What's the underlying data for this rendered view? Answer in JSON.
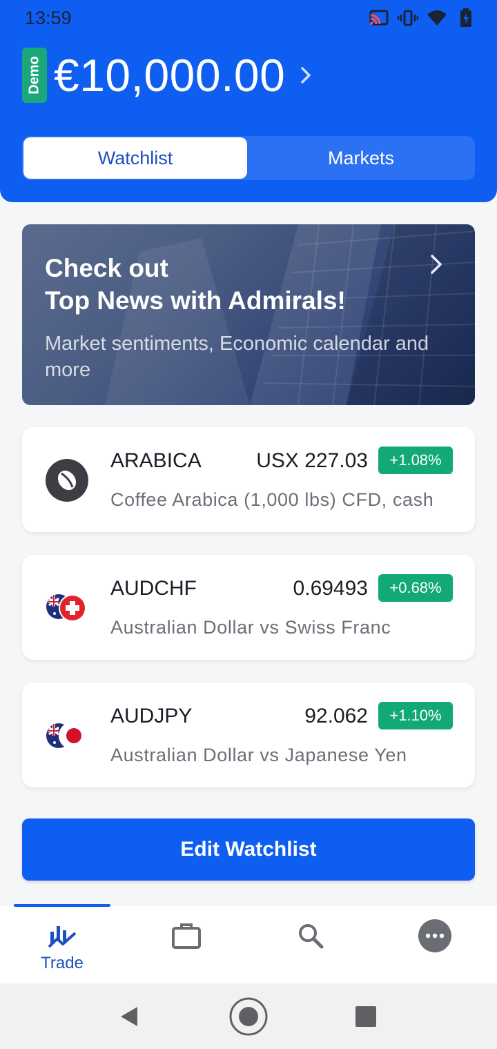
{
  "status_bar": {
    "time": "13:59"
  },
  "account": {
    "badge": "Demo",
    "balance": "€10,000.00"
  },
  "tabs": [
    {
      "label": "Watchlist",
      "active": true
    },
    {
      "label": "Markets",
      "active": false
    }
  ],
  "banner": {
    "title_line1": "Check out",
    "title_line2": "Top News with Admirals!",
    "subtitle": "Market sentiments, Economic calendar and more"
  },
  "watchlist": [
    {
      "symbol": "ARABICA",
      "price": "USX 227.03",
      "change": "+1.08%",
      "description": "Coffee Arabica (1,000 lbs) CFD, cash",
      "icon": "coffee-bean-icon"
    },
    {
      "symbol": "AUDCHF",
      "price": "0.69493",
      "change": "+0.68%",
      "description": "Australian Dollar vs Swiss Franc",
      "icon": "au-ch-flags-icon"
    },
    {
      "symbol": "AUDJPY",
      "price": "92.062",
      "change": "+1.10%",
      "description": "Australian Dollar vs Japanese Yen",
      "icon": "au-jp-flags-icon"
    }
  ],
  "edit_button": "Edit Watchlist",
  "bottom_nav": [
    {
      "label": "Trade",
      "icon": "trade-chart-icon",
      "active": true
    },
    {
      "label": "",
      "icon": "briefcase-icon",
      "active": false
    },
    {
      "label": "",
      "icon": "search-icon",
      "active": false
    },
    {
      "label": "",
      "icon": "more-icon",
      "active": false
    }
  ],
  "colors": {
    "brand": "#0f5ef2",
    "positive": "#12a877",
    "demo": "#1aa87a"
  }
}
